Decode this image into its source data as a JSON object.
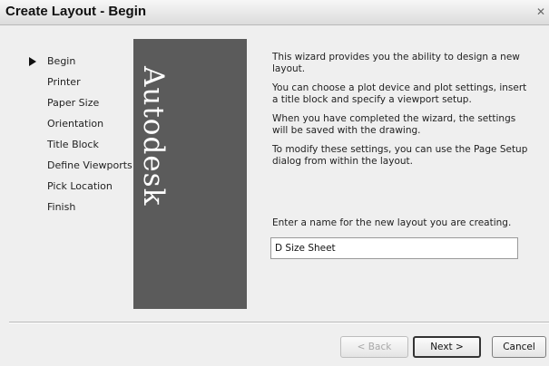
{
  "window": {
    "title": "Create Layout - Begin"
  },
  "steps": [
    {
      "label": "Begin",
      "current": true
    },
    {
      "label": "Printer",
      "current": false
    },
    {
      "label": "Paper Size",
      "current": false
    },
    {
      "label": "Orientation",
      "current": false
    },
    {
      "label": "Title Block",
      "current": false
    },
    {
      "label": "Define Viewports",
      "current": false
    },
    {
      "label": "Pick Location",
      "current": false
    },
    {
      "label": "Finish",
      "current": false
    }
  ],
  "brand": {
    "text": "Autodesk",
    "color": "#5b5b5b"
  },
  "description": [
    "This wizard provides you the ability to design a new layout.",
    "You can choose a plot device and plot settings, insert a title block and specify a viewport setup.",
    "When you have completed the wizard, the settings will be saved with the drawing.",
    "To modify these settings, you can use the Page Setup dialog from within the layout."
  ],
  "name_field": {
    "label": "Enter a name for the new layout you are creating.",
    "value": "D Size Sheet"
  },
  "buttons": {
    "back": "< Back",
    "next": "Next >",
    "cancel": "Cancel"
  },
  "icons": {
    "close": "close-icon",
    "current_step": "current-step-arrow-icon"
  }
}
